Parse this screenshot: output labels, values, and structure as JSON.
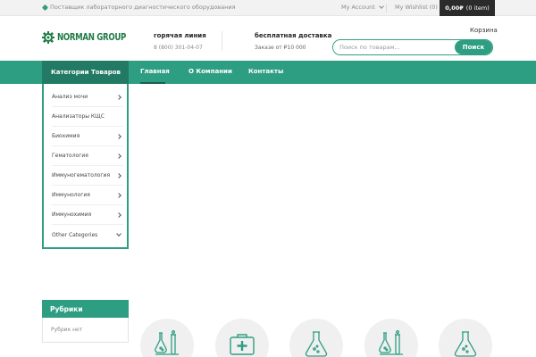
{
  "topbar": {
    "tagline": "Поставщик лабораторного диагностического оборудования",
    "account": "My Account",
    "wishlist": "My Wishlist (0)",
    "cart_amount": "0,00₽",
    "cart_items": "(0 item)"
  },
  "header": {
    "logo_text": "NORMAN GROUP",
    "hotline_title": "горячая линия",
    "hotline_phone": "8 (800) 301-04-07",
    "delivery_title": "бесплатная доставка",
    "delivery_sub": "Заказе от ₽10 000",
    "basket_label": "Корзина",
    "search_placeholder": "Поиск по товарам...",
    "search_button": "Поиск"
  },
  "nav": {
    "categories_tab": "Категории Товаров",
    "items": [
      "Главная",
      "О Компании",
      "Контакты"
    ],
    "active": "Главная"
  },
  "categories": [
    {
      "label": "Анализ мочи",
      "icon": "chevron-right"
    },
    {
      "label": "Анализаторы КЩС",
      "icon": ""
    },
    {
      "label": "Биохимия",
      "icon": "chevron-right"
    },
    {
      "label": "Гематология",
      "icon": "chevron-right"
    },
    {
      "label": "Иммуногематология",
      "icon": "chevron-right"
    },
    {
      "label": "Иммунология",
      "icon": "chevron-right"
    },
    {
      "label": "Иммунохимия",
      "icon": "chevron-right"
    },
    {
      "label": "Other Categories",
      "icon": "chevron-down"
    }
  ],
  "rubrics": {
    "title": "Рубрики",
    "empty": "Рубрик нет"
  },
  "feature_icons": [
    "lab-flask-tubes-icon",
    "medical-kit-icon",
    "flask-icon",
    "lab-flask-tubes-icon",
    "flask-icon"
  ],
  "colors": {
    "accent": "#2e9e82",
    "accent_dark": "#237a64",
    "logo_green": "#1f7a45",
    "cart_bg": "#2b2b2b"
  }
}
